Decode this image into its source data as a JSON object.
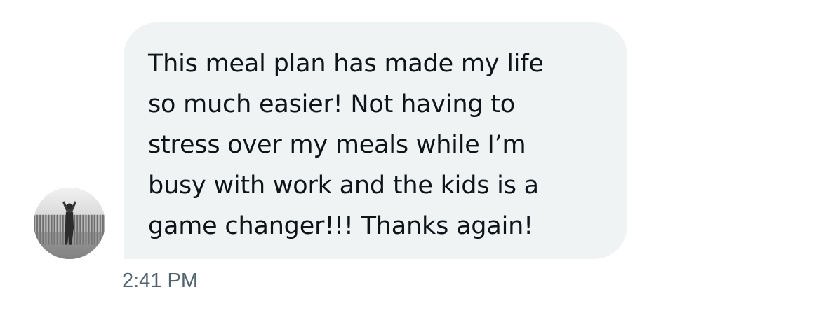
{
  "message": {
    "text": "This meal plan has made my life\nso much easier! Not having to\nstress over my meals while I’m\nbusy with work and the kids is a\ngame changer!!! Thanks again!",
    "timestamp": "2:41 PM"
  },
  "sender": {
    "avatar_icon": "user-avatar-photo"
  },
  "colors": {
    "bubble_background": "#eff3f4",
    "text": "#0f1419",
    "timestamp": "#536471"
  }
}
